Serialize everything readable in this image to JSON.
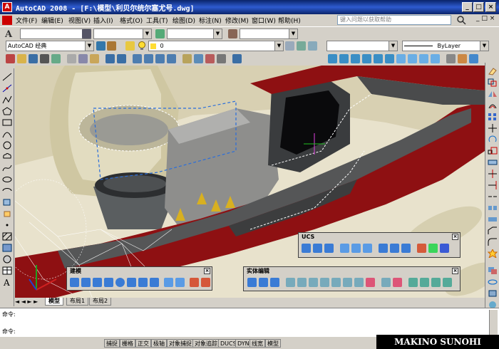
{
  "window": {
    "title": "AutoCAD 2008 - [F:\\模型\\利贝尔统尔塞尤号.dwg]"
  },
  "menu": [
    "文件(F)",
    "编辑(E)",
    "视图(V)",
    "插入(I)",
    "格式(O)",
    "工具(T)",
    "绘图(D)",
    "标注(N)",
    "修改(M)",
    "窗口(W)",
    "帮助(H)"
  ],
  "help": {
    "placeholder": "键入问题以获取帮助"
  },
  "toolbar": {
    "workspace": "AutoCAD 经典",
    "layer": "0",
    "linetype": "ByLayer"
  },
  "panels": {
    "ucs": {
      "title": "UCS"
    },
    "modeling": {
      "title": "建模"
    },
    "solid_edit": {
      "title": "实体编辑"
    }
  },
  "layout_tabs": [
    "模型",
    "布局1",
    "布局2"
  ],
  "command": {
    "line1": "命令:",
    "line2": "命令:"
  },
  "status": [
    "捕捉",
    "栅格",
    "正交",
    "极轴",
    "对象捕捉",
    "对象追踪",
    "DUCS",
    "DYN",
    "线宽",
    "模型"
  ],
  "watermark": "MAKINO SUNOHI"
}
